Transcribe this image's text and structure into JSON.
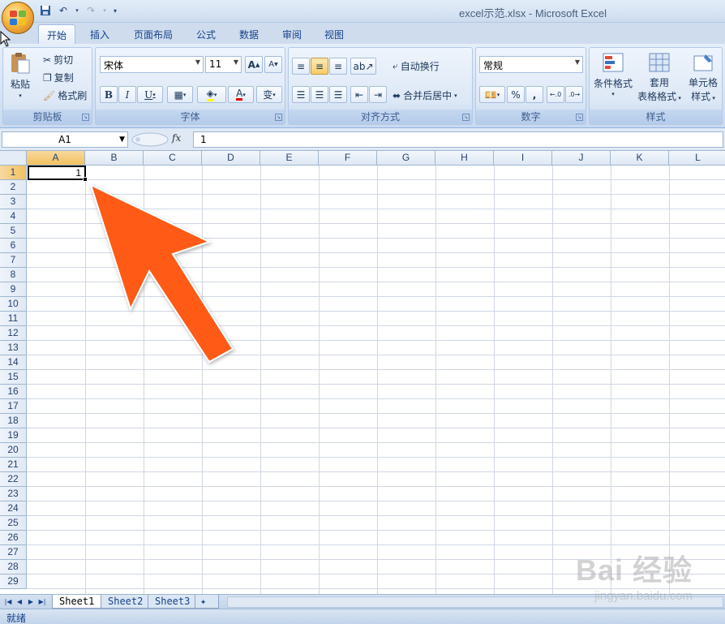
{
  "window": {
    "title": "excel示范.xlsx - Microsoft Excel"
  },
  "quick_access": {
    "icons": [
      "save-icon",
      "undo-icon",
      "redo-icon",
      "customize-icon"
    ]
  },
  "tabs": [
    "开始",
    "插入",
    "页面布局",
    "公式",
    "数据",
    "审阅",
    "视图"
  ],
  "active_tab": "开始",
  "ribbon": {
    "clipboard": {
      "label": "剪贴板",
      "paste": "粘贴",
      "cut": "剪切",
      "copy": "复制",
      "format_painter": "格式刷"
    },
    "font": {
      "label": "字体",
      "font_name": "宋体",
      "font_size": "11",
      "bold": "B",
      "italic": "I",
      "underline": "U",
      "grow": "A",
      "shrink": "A",
      "font_color": "A",
      "phonetic": "变"
    },
    "alignment": {
      "label": "对齐方式",
      "wrap_text": "自动换行",
      "merge_center": "合并后居中"
    },
    "number": {
      "label": "数字",
      "format": "常规",
      "percent": "%",
      "comma": ","
    },
    "styles": {
      "label": "样式",
      "conditional": "条件格式",
      "table_line1": "套用",
      "table_line2": "表格格式",
      "cell_line1": "单元格",
      "cell_line2": "样式"
    }
  },
  "formula_bar": {
    "name_box": "A1",
    "fx": "fx",
    "value": "1"
  },
  "grid": {
    "columns": [
      "A",
      "B",
      "C",
      "D",
      "E",
      "F",
      "G",
      "H",
      "I",
      "J",
      "K",
      "L"
    ],
    "rows": [
      "1",
      "2",
      "3",
      "4",
      "5",
      "6",
      "7",
      "8",
      "9",
      "10",
      "11",
      "12",
      "13",
      "14",
      "15",
      "16",
      "17",
      "18",
      "19",
      "20",
      "21",
      "22",
      "23",
      "24",
      "25",
      "26",
      "27",
      "28",
      "29"
    ],
    "selected_cell": "A1",
    "cells": {
      "A1": "1"
    }
  },
  "sheets": [
    "Sheet1",
    "Sheet2",
    "Sheet3"
  ],
  "active_sheet": "Sheet1",
  "status": {
    "text": "就绪"
  },
  "watermark": {
    "logo": "Bai 经验",
    "url": "jingyan.baidu.com"
  },
  "colors": {
    "annotation_arrow": "#ff5a14",
    "selection_header": "#f1c15f"
  }
}
